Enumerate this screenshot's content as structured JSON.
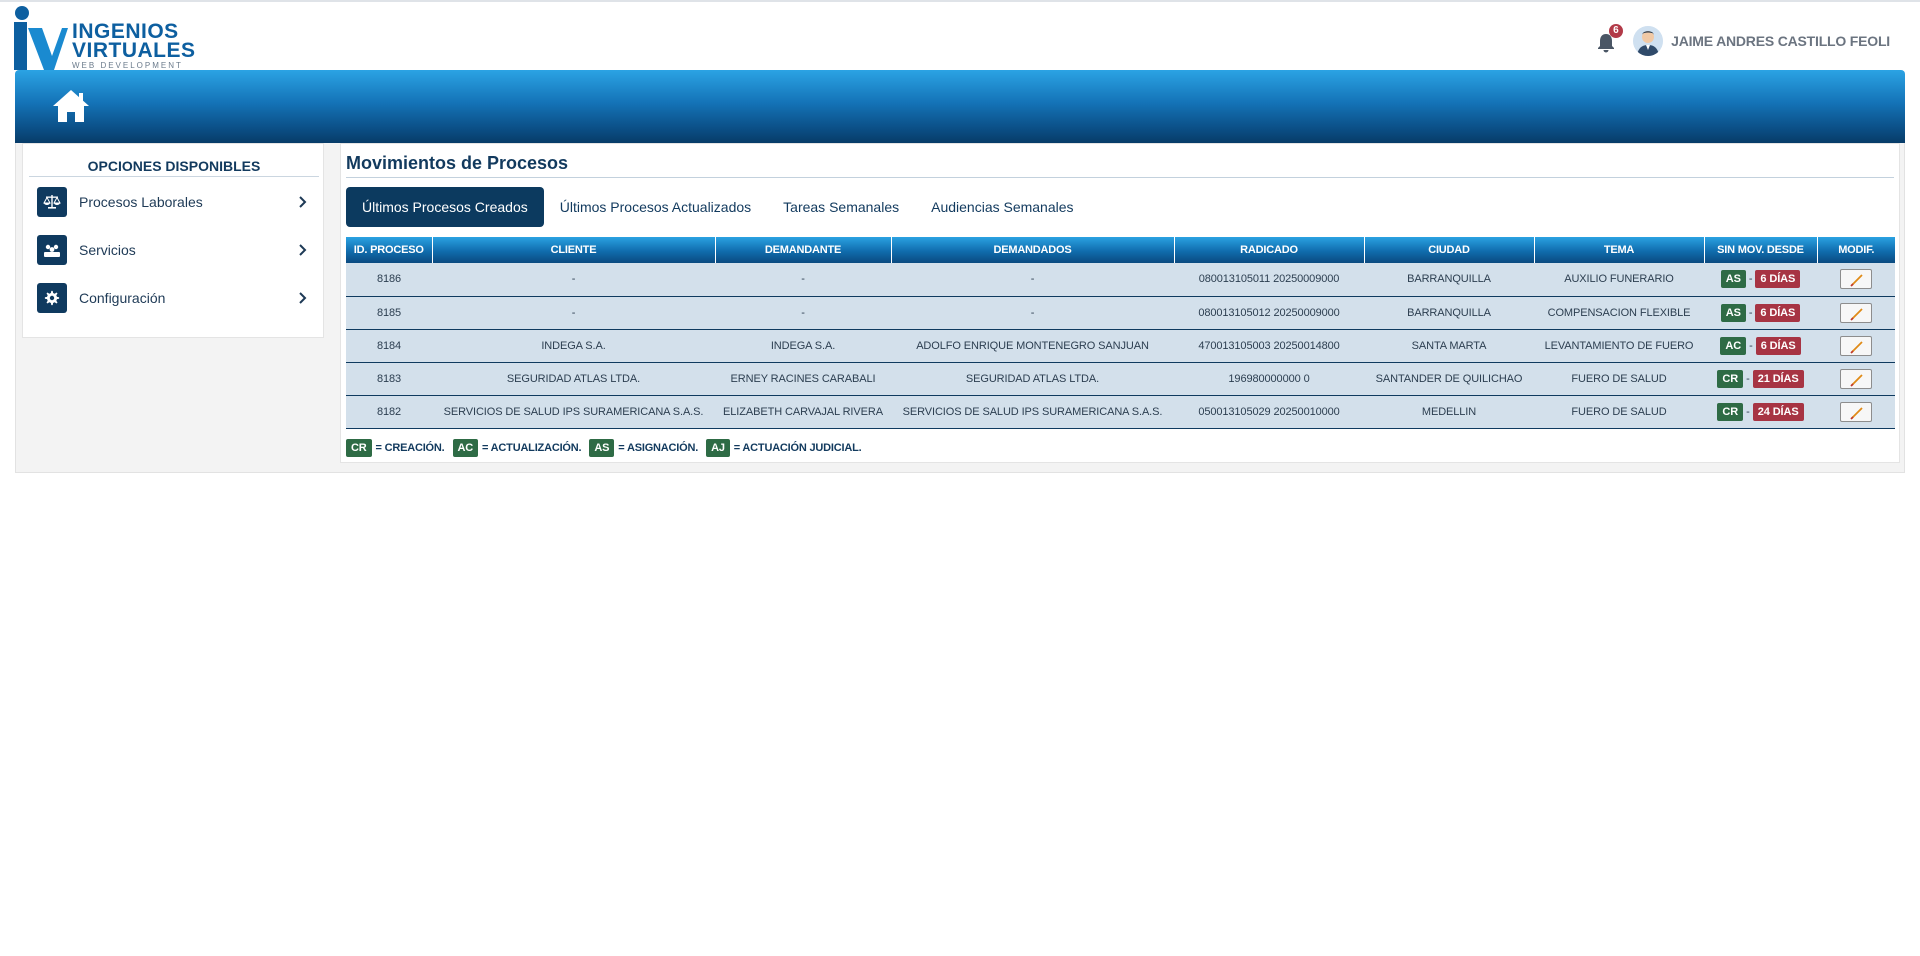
{
  "brand": {
    "line1": "INGENIOS",
    "line2": "VIRTUALES",
    "line3": "WEB DEVELOPMENT"
  },
  "header": {
    "notifications_count": "6",
    "user_name": "JAIME ANDRES CASTILLO FEOLI"
  },
  "sidebar": {
    "title": "OPCIONES DISPONIBLES",
    "items": [
      {
        "label": "Procesos Laborales",
        "icon": "scale-icon"
      },
      {
        "label": "Servicios",
        "icon": "users-icon"
      },
      {
        "label": "Configuración",
        "icon": "gear-icon"
      }
    ]
  },
  "main": {
    "title": "Movimientos de Procesos",
    "tabs": [
      {
        "label": "Últimos Procesos Creados",
        "active": true
      },
      {
        "label": "Últimos Procesos Actualizados",
        "active": false
      },
      {
        "label": "Tareas Semanales",
        "active": false
      },
      {
        "label": "Audiencias Semanales",
        "active": false
      }
    ],
    "columns": [
      "ID. PROCESO",
      "CLIENTE",
      "DEMANDANTE",
      "DEMANDADOS",
      "RADICADO",
      "CIUDAD",
      "TEMA",
      "SIN MOV. DESDE",
      "MODIF."
    ],
    "rows": [
      {
        "id": "8186",
        "cliente": "-",
        "demandante": "-",
        "demandados": "-",
        "radicado": "080013105011 20250009000",
        "ciudad": "BARRANQUILLA",
        "tema": "AUXILIO FUNERARIO",
        "tipo": "AS",
        "sep": "-",
        "dias": "6 DÍAS"
      },
      {
        "id": "8185",
        "cliente": "-",
        "demandante": "-",
        "demandados": "-",
        "radicado": "080013105012 20250009000",
        "ciudad": "BARRANQUILLA",
        "tema": "COMPENSACION FLEXIBLE",
        "tipo": "AS",
        "sep": "-",
        "dias": "6 DÍAS"
      },
      {
        "id": "8184",
        "cliente": "INDEGA S.A.",
        "demandante": "INDEGA S.A.",
        "demandados": "ADOLFO ENRIQUE MONTENEGRO SANJUAN",
        "radicado": "470013105003 20250014800",
        "ciudad": "SANTA MARTA",
        "tema": "LEVANTAMIENTO DE FUERO",
        "tipo": "AC",
        "sep": "-",
        "dias": "6 DÍAS"
      },
      {
        "id": "8183",
        "cliente": "SEGURIDAD ATLAS LTDA.",
        "demandante": "ERNEY RACINES CARABALI",
        "demandados": "SEGURIDAD ATLAS LTDA.",
        "radicado": "196980000000 0",
        "ciudad": "SANTANDER DE QUILICHAO",
        "tema": "FUERO DE SALUD",
        "tipo": "CR",
        "sep": "-",
        "dias": "21 DÍAS"
      },
      {
        "id": "8182",
        "cliente": "SERVICIOS DE SALUD IPS SURAMERICANA S.A.S.",
        "demandante": "ELIZABETH CARVAJAL RIVERA",
        "demandados": "SERVICIOS DE SALUD IPS SURAMERICANA S.A.S.",
        "radicado": "050013105029 20250010000",
        "ciudad": "MEDELLIN",
        "tema": "FUERO DE SALUD",
        "tipo": "CR",
        "sep": "-",
        "dias": "24 DÍAS"
      }
    ],
    "legend": [
      {
        "code": "CR",
        "text": "= CREACIÓN."
      },
      {
        "code": "AC",
        "text": "= ACTUALIZACIÓN."
      },
      {
        "code": "AS",
        "text": "= ASIGNACIÓN."
      },
      {
        "code": "AJ",
        "text": "= ACTUACIÓN JUDICIAL."
      }
    ]
  },
  "colors": {
    "navy": "#0c3a5f",
    "green_tag": "#2e6b45",
    "red_tag": "#a73443",
    "row_bg": "#d3e0eb"
  }
}
